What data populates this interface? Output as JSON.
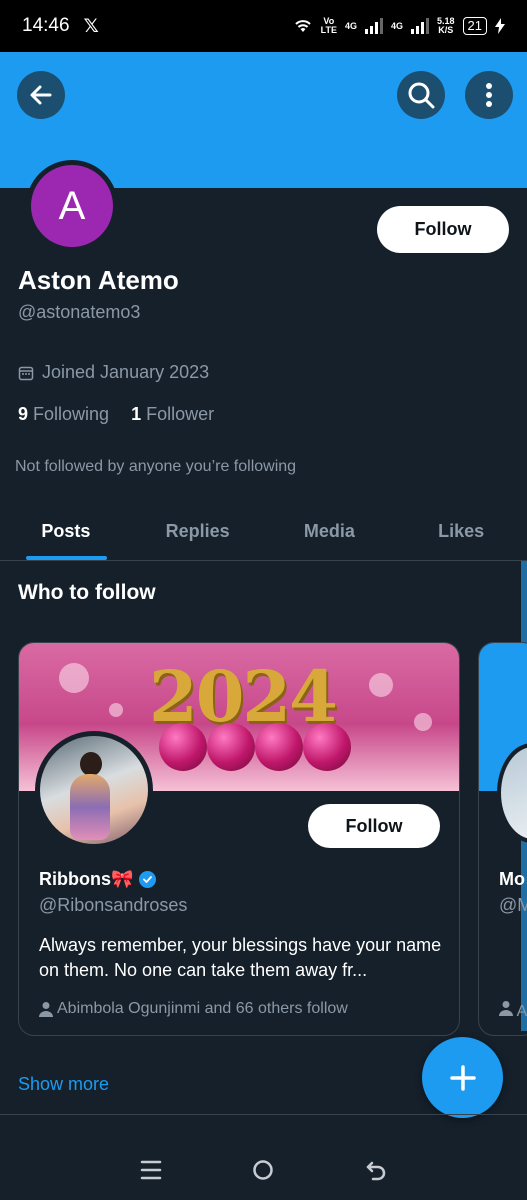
{
  "status_bar": {
    "time": "14:46",
    "x_logo": "𝕏",
    "volte_top": "Vo",
    "volte_bottom": "LTE",
    "net1": "4G",
    "net2": "4G",
    "speed_top": "5.18",
    "speed_bottom": "K/S",
    "battery": "21"
  },
  "header": {
    "back_icon": "arrow-left-icon",
    "search_icon": "search-icon",
    "more_icon": "more-vertical-icon",
    "banner_color": "#1d9bf0"
  },
  "profile": {
    "avatar_letter": "A",
    "avatar_color": "#9c27b0",
    "follow_label": "Follow",
    "name": "Aston Atemo",
    "handle": "@astonatemo3",
    "joined": "Joined January 2023",
    "following_count": "9",
    "following_label": "Following",
    "followers_count": "1",
    "followers_label": "Follower",
    "not_followed": "Not followed by anyone you’re following"
  },
  "tabs": [
    {
      "label": "Posts",
      "active": true
    },
    {
      "label": "Replies",
      "active": false
    },
    {
      "label": "Media",
      "active": false
    },
    {
      "label": "Likes",
      "active": false
    }
  ],
  "who_to_follow": {
    "title": "Who to follow",
    "card": {
      "banner_text": "2024",
      "follow_label": "Follow",
      "name": "Ribbons🎀",
      "handle": "@Ribonsandroses",
      "bio": "Always remember, your blessings have your name on them. No one can take them away fr...",
      "social_context": "Abimbola Ogunjinmi and 66 others follow"
    },
    "peek_card": {
      "name": "Mo",
      "handle": "@M",
      "social": "A"
    },
    "show_more": "Show more"
  },
  "fab": {
    "icon": "plus-icon"
  },
  "nav": {
    "recents_icon": "recents-icon",
    "home_icon": "home-circle-icon",
    "back_icon": "back-icon"
  }
}
